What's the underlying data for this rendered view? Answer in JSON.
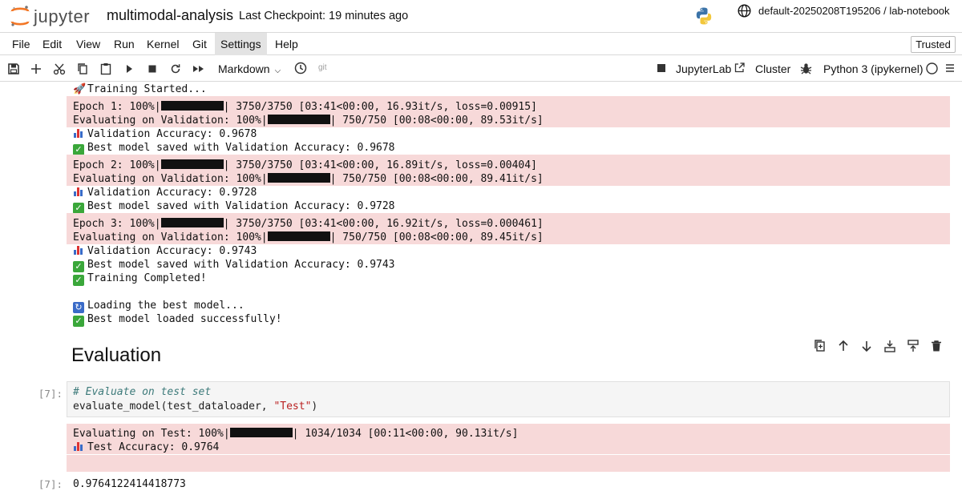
{
  "header": {
    "logo_text": "jupyter",
    "notebook_name": "multimodal-analysis",
    "checkpoint": "Last Checkpoint: 19 minutes ago",
    "server": "default-20250208T195206 / lab-notebook"
  },
  "menu": {
    "items": [
      "File",
      "Edit",
      "View",
      "Run",
      "Kernel",
      "Git",
      "Settings",
      "Help"
    ],
    "active": "Settings",
    "trusted": "Trusted"
  },
  "toolbar": {
    "cell_type": "Markdown",
    "git": "git",
    "jupyterlab": "JupyterLab",
    "cluster": "Cluster",
    "kernel": "Python 3 (ipykernel)"
  },
  "output_training": {
    "started": "Training Started...",
    "epochs": [
      {
        "epoch": "Epoch 1: 100%|",
        "epoch_tail": "| 3750/3750 [03:41<00:00, 16.93it/s, loss=0.00915]",
        "eval": "Evaluating on Validation: 100%|",
        "eval_tail": "| 750/750 [00:08<00:00, 89.53it/s]",
        "acc": "Validation Accuracy: 0.9678",
        "saved": "Best model saved with Validation Accuracy: 0.9678"
      },
      {
        "epoch": "Epoch 2: 100%|",
        "epoch_tail": "| 3750/3750 [03:41<00:00, 16.89it/s, loss=0.00404]",
        "eval": "Evaluating on Validation: 100%|",
        "eval_tail": "| 750/750 [00:08<00:00, 89.41it/s]",
        "acc": "Validation Accuracy: 0.9728",
        "saved": "Best model saved with Validation Accuracy: 0.9728"
      },
      {
        "epoch": "Epoch 3: 100%|",
        "epoch_tail": "| 3750/3750 [03:41<00:00, 16.92it/s, loss=0.000461]",
        "eval": "Evaluating on Validation: 100%|",
        "eval_tail": "| 750/750 [00:08<00:00, 89.45it/s]",
        "acc": "Validation Accuracy: 0.9743",
        "saved": "Best model saved with Validation Accuracy: 0.9743"
      }
    ],
    "completed": "Training Completed!",
    "loading": "Loading the best model...",
    "loaded": "Best model loaded successfully!"
  },
  "markdown": {
    "heading": "Evaluation"
  },
  "code_cell": {
    "prompt": "[7]:",
    "comment": "# Evaluate on test set",
    "code_pre": "evaluate_model(test_dataloader, ",
    "code_str": "\"Test\"",
    "code_post": ")",
    "stderr_head": "Evaluating on Test: 100%|",
    "stderr_tail": "| 1034/1034 [00:11<00:00, 90.13it/s]",
    "test_acc": "Test Accuracy: 0.9764",
    "result_prompt": "[7]:",
    "result": "0.9764122414418773"
  }
}
